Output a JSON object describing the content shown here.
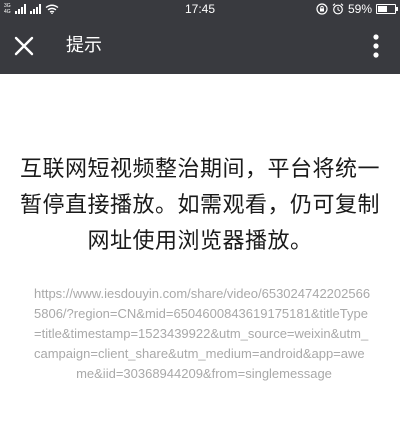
{
  "status_bar": {
    "network_top": "3G",
    "network_bottom": "4G",
    "time": "17:45",
    "battery_text": "59%",
    "battery_level": 0.59
  },
  "title_bar": {
    "title": "提示",
    "close_icon": "close-icon",
    "more_icon": "more-vertical-icon",
    "background": "#393a3f"
  },
  "content": {
    "message": "互联网短视频整治期间，平台将统一暂停直接播放。如需观看，仍可复制网址使用浏览器播放。",
    "url": "https://www.iesdouyin.com/share/video/6530247422025665806/?region=CN&mid=6504600843619175181&titleType=title&timestamp=1523439922&utm_source=weixin&utm_campaign=client_share&utm_medium=android&app=aweme&iid=30368944209&from=singlemessage",
    "url_color": "#a9a9a9"
  }
}
